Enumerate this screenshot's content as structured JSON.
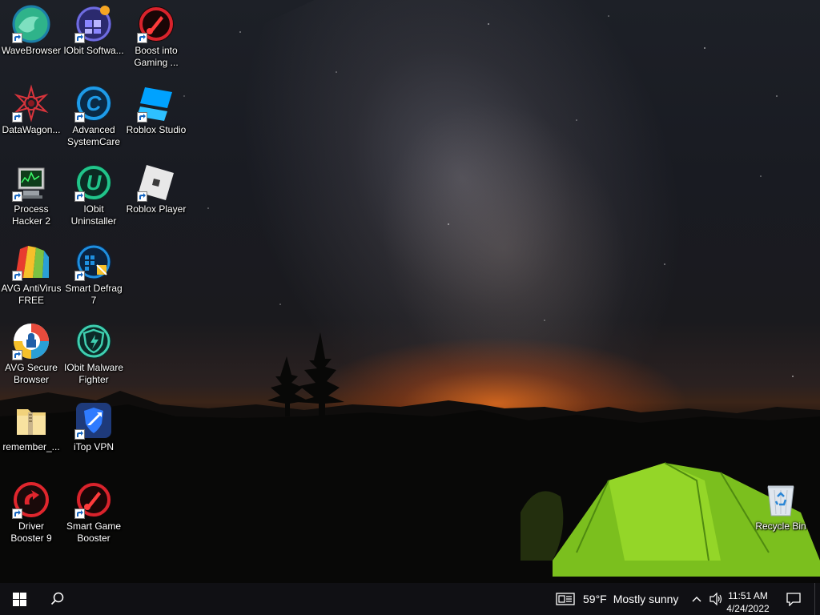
{
  "desktop": {
    "icons": [
      {
        "id": "wavebrowser",
        "label": "WaveBrowser"
      },
      {
        "id": "iobit-software",
        "label": "IObit Softwa..."
      },
      {
        "id": "boost-gaming",
        "label": "Boost into Gaming ..."
      },
      {
        "id": "datawagon",
        "label": "DataWagon..."
      },
      {
        "id": "advanced-systemcare",
        "label": "Advanced SystemCare"
      },
      {
        "id": "roblox-studio",
        "label": "Roblox Studio"
      },
      {
        "id": "process-hacker",
        "label": "Process Hacker 2"
      },
      {
        "id": "iobit-uninstaller",
        "label": "IObit Uninstaller"
      },
      {
        "id": "roblox-player",
        "label": "Roblox Player"
      },
      {
        "id": "avg-antivirus",
        "label": "AVG AntiVirus FREE"
      },
      {
        "id": "smart-defrag",
        "label": "Smart Defrag 7"
      },
      {
        "id": "avg-secure-browser",
        "label": "AVG Secure Browser"
      },
      {
        "id": "iobit-malware",
        "label": "IObit Malware Fighter"
      },
      {
        "id": "remember-folder",
        "label": "remember_..."
      },
      {
        "id": "itop-vpn",
        "label": "iTop VPN"
      },
      {
        "id": "driver-booster",
        "label": "Driver Booster 9"
      },
      {
        "id": "smart-game-booster",
        "label": "Smart Game Booster"
      },
      {
        "id": "recycle-bin",
        "label": "Recycle Bin"
      }
    ]
  },
  "taskbar": {
    "weather": {
      "temperature": "59°F",
      "condition": "Mostly sunny"
    },
    "clock": {
      "time": "11:51 AM",
      "date": "4/24/2022"
    }
  },
  "colors": {
    "taskbar": "#101014",
    "accent": "#0078d7"
  }
}
